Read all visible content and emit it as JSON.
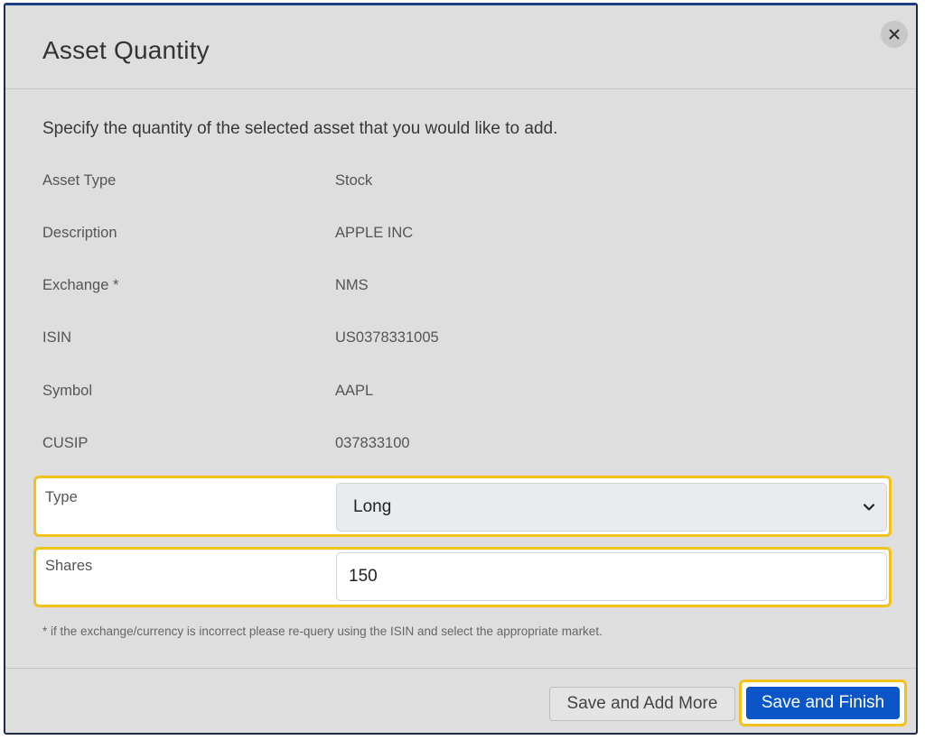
{
  "dialog": {
    "title": "Asset Quantity",
    "close_icon": "close-icon",
    "intro": "Specify the quantity of the selected asset that you would like to add."
  },
  "fields": [
    {
      "label": "Asset Type",
      "value": "Stock"
    },
    {
      "label": "Description",
      "value": "APPLE INC"
    },
    {
      "label": "Exchange *",
      "value": "NMS"
    },
    {
      "label": "ISIN",
      "value": "US0378331005"
    },
    {
      "label": "Symbol",
      "value": "AAPL"
    },
    {
      "label": "CUSIP",
      "value": "037833100"
    }
  ],
  "type_field": {
    "label": "Type",
    "selected": "Long",
    "icon": "chevron-down-icon"
  },
  "shares_field": {
    "label": "Shares",
    "value": "150"
  },
  "footnote": "* if the exchange/currency is incorrect please re-query using the ISIN and select the appropriate market.",
  "buttons": {
    "save_add_more": "Save and Add More",
    "save_finish": "Save and Finish"
  },
  "colors": {
    "primary": "#0a56c8",
    "highlight": "#f2c21b",
    "dialog_background": "#dedede"
  }
}
